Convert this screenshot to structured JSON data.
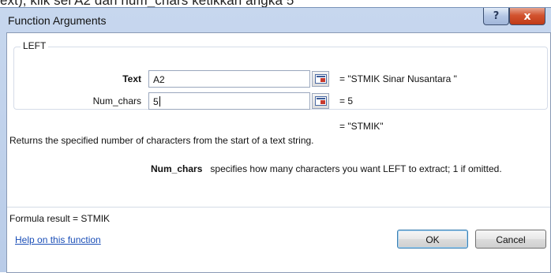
{
  "background_text": "ext), klik sel A2 dan num_chars ketikkan angka 5",
  "dialog": {
    "title": "Function Arguments",
    "help_glyph": "?",
    "close_glyph": "x",
    "function_name": "LEFT"
  },
  "arguments": [
    {
      "label": "Text",
      "value": "A2",
      "evaluated": "=  \"STMIK Sinar Nusantara \""
    },
    {
      "label": "Num_chars",
      "value": "5",
      "evaluated": "=  5"
    }
  ],
  "result_preview": "=  \"STMIK\"",
  "description": "Returns the specified number of characters from the start of a text string.",
  "arg_help": {
    "name": "Num_chars",
    "text": "specifies how many characters you want LEFT to extract; 1 if omitted."
  },
  "formula_result": "Formula result =   STMIK",
  "help_link": "Help on this function",
  "buttons": {
    "ok": "OK",
    "cancel": "Cancel"
  },
  "icons": {
    "reference": "collapse-dialog-icon",
    "help": "help-icon",
    "close": "close-icon"
  }
}
